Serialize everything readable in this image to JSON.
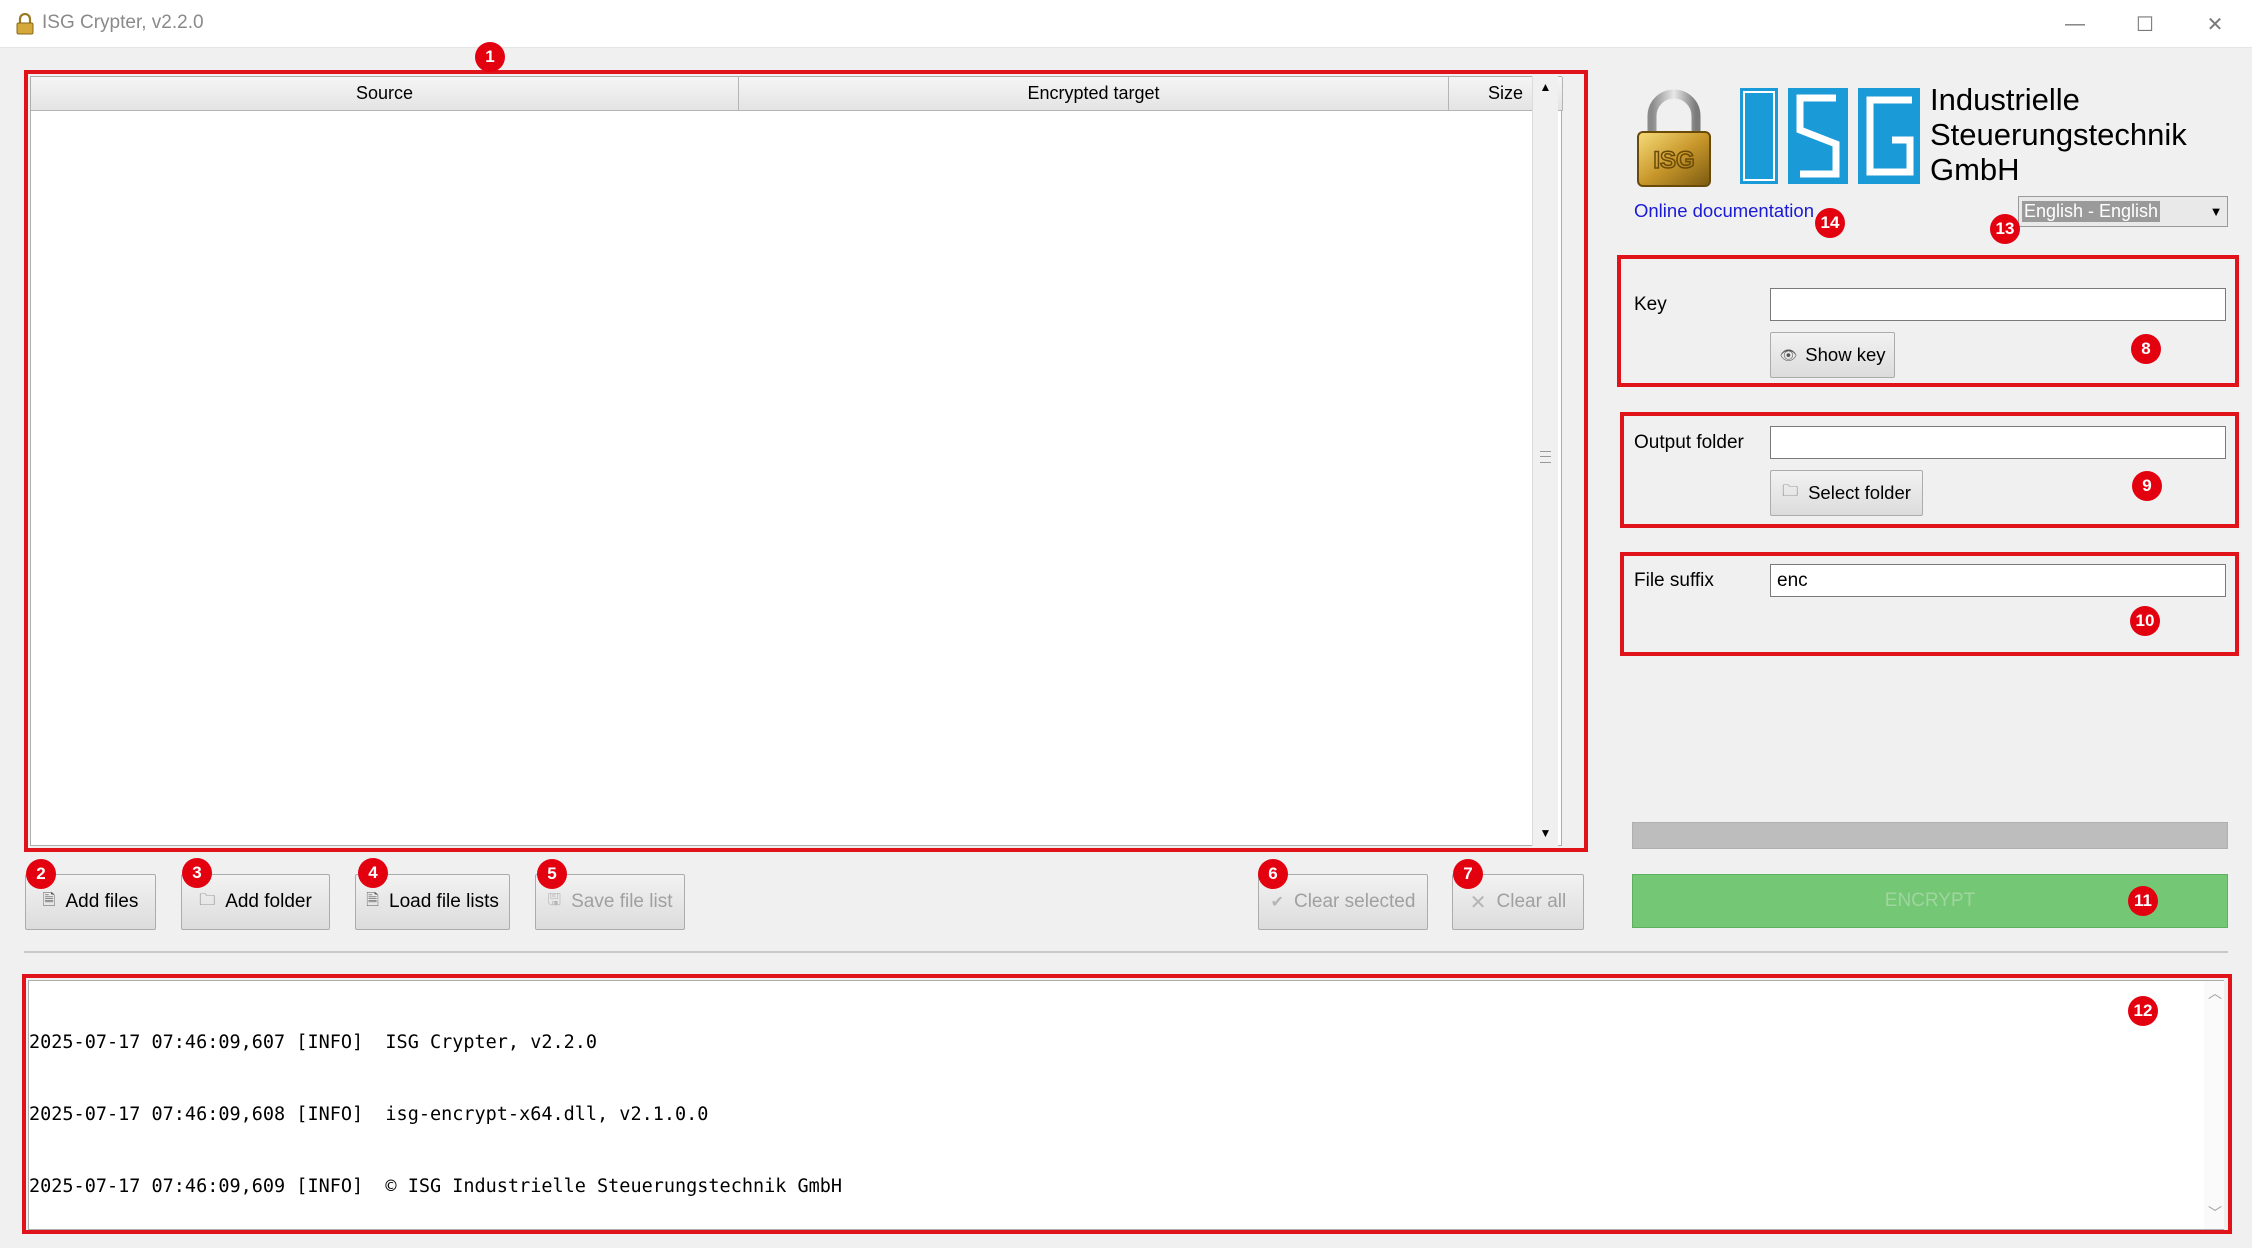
{
  "window": {
    "title": "ISG Crypter, v2.2.0",
    "minimize_glyph": "—",
    "maximize_glyph": "☐",
    "close_glyph": "✕"
  },
  "file_table": {
    "columns": [
      "Source",
      "Encrypted target",
      "Size"
    ],
    "rows": []
  },
  "buttons": {
    "add_files": "Add files",
    "add_folder": "Add folder",
    "load_file_lists": "Load file lists",
    "save_file_list": "Save file list",
    "clear_selected": "Clear selected",
    "clear_all": "Clear all",
    "show_key": "Show key",
    "select_folder": "Select folder",
    "encrypt": "ENCRYPT"
  },
  "branding": {
    "company_line1": "Industrielle",
    "company_line2": "Steuerungstechnik",
    "company_line3": "GmbH",
    "logo_text": "ISG",
    "online_doc_link": "Online documentation"
  },
  "language": {
    "selected": "English - English"
  },
  "settings": {
    "key_label": "Key",
    "key_value": "",
    "output_folder_label": "Output folder",
    "output_folder_value": "",
    "file_suffix_label": "File suffix",
    "file_suffix_value": "enc"
  },
  "progress": {
    "value": 0
  },
  "log": {
    "lines": [
      "2025-07-17 07:46:09,607 [INFO]  ISG Crypter, v2.2.0",
      "2025-07-17 07:46:09,608 [INFO]  isg-encrypt-x64.dll, v2.1.0.0",
      "2025-07-17 07:46:09,609 [INFO]  © ISG Industrielle Steuerungstechnik GmbH"
    ]
  },
  "annotations": [
    "1",
    "2",
    "3",
    "4",
    "5",
    "6",
    "7",
    "8",
    "9",
    "10",
    "11",
    "12",
    "13",
    "14"
  ],
  "colors": {
    "annotation_red": "#e0131b",
    "encrypt_green": "#74c774",
    "logo_blue": "#1a9ad6",
    "link_blue": "#1a1ad6"
  }
}
